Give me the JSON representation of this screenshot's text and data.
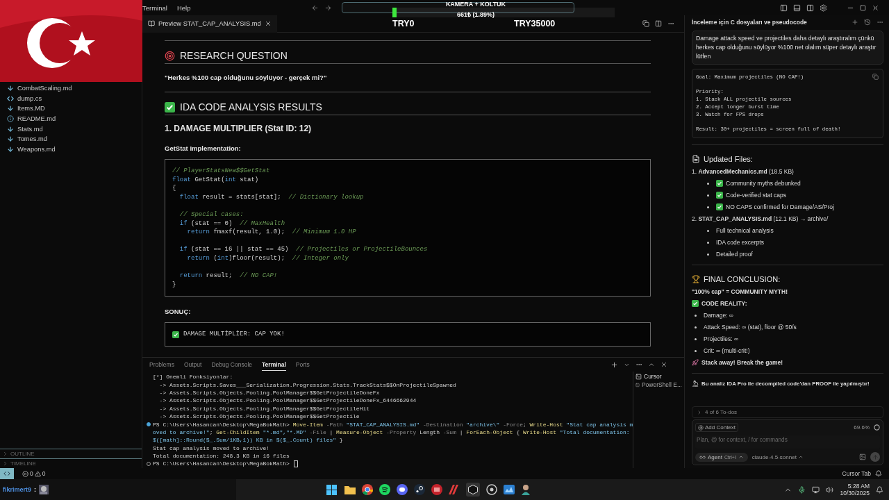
{
  "menu": [
    {
      "label": "Terminal"
    },
    {
      "label": "Help"
    }
  ],
  "overlay": {
    "title": "KAMERA + KOLTUK",
    "amount": "661₺ (1.89%)",
    "level": 0.0189,
    "min": "TRY0",
    "max": "TRY35000"
  },
  "files": [
    {
      "name": "CombatScaling.md",
      "kind": "md"
    },
    {
      "name": "dump.cs",
      "kind": "cs"
    },
    {
      "name": "Items.MD",
      "kind": "md"
    },
    {
      "name": "README.md",
      "kind": "info"
    },
    {
      "name": "Stats.md",
      "kind": "md"
    },
    {
      "name": "Tomes.md",
      "kind": "md"
    },
    {
      "name": "Weapons.md",
      "kind": "md"
    }
  ],
  "sidebar_sections": [
    {
      "label": "OUTLINE",
      "expanded": false
    },
    {
      "label": "TIMELINE",
      "expanded": false
    }
  ],
  "editor_tab": {
    "label": "Preview STAT_CAP_ANALYSIS.md"
  },
  "preview": [
    {
      "kind": "hr"
    },
    {
      "kind": "h2",
      "text": "RESEARCH QUESTION"
    },
    {
      "kind": "bold",
      "text": "\"Herkes %100 cap olduğunu söylüyor - gerçek mi?\""
    },
    {
      "kind": "hr"
    },
    {
      "kind": "h2",
      "text": "IDA CODE ANALYSIS RESULTS"
    },
    {
      "kind": "h3",
      "text": "1. DAMAGE MULTIPLIER (Stat ID: 12)"
    },
    {
      "kind": "bold",
      "text": "GetStat Implementation:"
    },
    {
      "kind": "code",
      "lines": [
        {
          "kind": "code",
          "segs": [
            {
              "kind": "cm",
              "text": "// PlayerStatsNew$$GetStat"
            }
          ]
        },
        {
          "kind": "code",
          "segs": [
            {
              "kind": "kw",
              "text": "float"
            },
            {
              "kind": "tx",
              "text": " GetStat("
            },
            {
              "kind": "kw",
              "text": "int"
            },
            {
              "kind": "tx",
              "text": " stat)"
            }
          ]
        },
        {
          "kind": "code",
          "segs": [
            {
              "kind": "tx",
              "text": "{"
            }
          ]
        },
        {
          "kind": "code",
          "segs": [
            {
              "kind": "kw",
              "text": "  float"
            },
            {
              "kind": "tx",
              "text": " result = stats[stat];  "
            },
            {
              "kind": "cm",
              "text": "// Dictionary lookup"
            }
          ]
        },
        {
          "kind": "blank"
        },
        {
          "kind": "code",
          "segs": [
            {
              "kind": "cm",
              "text": "  // Special cases:"
            }
          ]
        },
        {
          "kind": "code",
          "segs": [
            {
              "kind": "kw",
              "text": "  if"
            },
            {
              "kind": "tx",
              "text": " (stat == 0)  "
            },
            {
              "kind": "cm",
              "text": "// MaxHealth"
            }
          ]
        },
        {
          "kind": "code",
          "segs": [
            {
              "kind": "kw",
              "text": "    return"
            },
            {
              "kind": "tx",
              "text": " fmaxf(result, 1.0);  "
            },
            {
              "kind": "cm",
              "text": "// Minimum 1.0 HP"
            }
          ]
        },
        {
          "kind": "blank"
        },
        {
          "kind": "code",
          "segs": [
            {
              "kind": "kw",
              "text": "  if"
            },
            {
              "kind": "tx",
              "text": " (stat == 16 || stat == 45)  "
            },
            {
              "kind": "cm",
              "text": "// Projectiles or ProjectileBounces"
            }
          ]
        },
        {
          "kind": "code",
          "segs": [
            {
              "kind": "kw",
              "text": "    return"
            },
            {
              "kind": "tx",
              "text": " ("
            },
            {
              "kind": "kw",
              "text": "int"
            },
            {
              "kind": "tx",
              "text": ")floor(result);  "
            },
            {
              "kind": "cm",
              "text": "// Integer only"
            }
          ]
        },
        {
          "kind": "blank"
        },
        {
          "kind": "code",
          "segs": [
            {
              "kind": "kw",
              "text": "  return"
            },
            {
              "kind": "tx",
              "text": " result;  "
            },
            {
              "kind": "cm",
              "text": "// NO CAP!"
            }
          ]
        },
        {
          "kind": "code",
          "segs": [
            {
              "kind": "tx",
              "text": "}"
            }
          ]
        }
      ]
    },
    {
      "kind": "bold",
      "text": "SONUÇ:"
    },
    {
      "kind": "code",
      "lines": [
        {
          "kind": "check",
          "segs": [
            {
              "kind": "tx",
              "text": "DAMAGE MULTİPLİER: CAP YOK!"
            }
          ]
        }
      ]
    }
  ],
  "terminal": {
    "tabs": [
      {
        "label": "Problems",
        "selected": false
      },
      {
        "label": "Output",
        "selected": false
      },
      {
        "label": "Debug Console",
        "selected": false
      },
      {
        "label": "Terminal",
        "selected": true
      },
      {
        "label": "Ports",
        "selected": false
      }
    ],
    "rows": [
      {
        "kind": "out",
        "text": "[*] Onemli Fonksiyonlar:"
      },
      {
        "kind": "out",
        "text": "  -> Assets.Scripts.Saves___Serialization.Progression.Stats.TrackStats$$OnProjectileSpawned"
      },
      {
        "kind": "out",
        "text": "  -> Assets.Scripts.Objects.Pooling.PoolManager$$GetProjectileDoneFx"
      },
      {
        "kind": "out",
        "text": "  -> Assets.Scripts.Objects.Pooling.PoolManager$$GetProjectileDoneFx_6446662944"
      },
      {
        "kind": "out",
        "text": "  -> Assets.Scripts.Objects.Pooling.PoolManager$$GetProjectileHit"
      },
      {
        "kind": "out",
        "text": "  -> Assets.Scripts.Objects.Pooling.PoolManager$$GetProjectile"
      },
      {
        "kind": "cmd",
        "segs": [
          {
            "kind": "tx",
            "text": "PS C:\\Users\\Hasancan\\Desktop\\MegaBokMath> "
          },
          {
            "kind": "cmd",
            "text": "Move-Item"
          },
          {
            "kind": "flag",
            "text": " -Path "
          },
          {
            "kind": "str",
            "text": "\"STAT_CAP_ANALYSIS.md\""
          },
          {
            "kind": "flag",
            "text": " -Destination "
          },
          {
            "kind": "str",
            "text": "\"archive\\\""
          },
          {
            "kind": "flag",
            "text": " -Force"
          },
          {
            "kind": "tx",
            "text": "; "
          },
          {
            "kind": "cmd",
            "text": "Write-Host"
          },
          {
            "kind": "str",
            "text": " \"Stat cap analysis m"
          }
        ]
      },
      {
        "kind": "cont",
        "segs": [
          {
            "kind": "str",
            "text": "oved to archive!\""
          },
          {
            "kind": "tx",
            "text": "; "
          },
          {
            "kind": "cmd",
            "text": "Get-ChildItem"
          },
          {
            "kind": "str",
            "text": " \"*.md\",\"*.MD\""
          },
          {
            "kind": "flag",
            "text": " -File "
          },
          {
            "kind": "tx",
            "text": "| "
          },
          {
            "kind": "cmd",
            "text": "Measure-Object"
          },
          {
            "kind": "flag",
            "text": " -Property "
          },
          {
            "kind": "tx",
            "text": "Length "
          },
          {
            "kind": "flag",
            "text": "-Sum "
          },
          {
            "kind": "tx",
            "text": "| "
          },
          {
            "kind": "cmd",
            "text": "ForEach-Object"
          },
          {
            "kind": "tx",
            "text": " { "
          },
          {
            "kind": "cmd",
            "text": "Write-Host"
          },
          {
            "kind": "str",
            "text": " \"Total documentation:"
          }
        ]
      },
      {
        "kind": "cont",
        "segs": [
          {
            "kind": "str",
            "text": "$([math]::Round($_.Sum/1KB,1)) KB in $($_.Count) files\""
          },
          {
            "kind": "tx",
            "text": " }"
          }
        ]
      },
      {
        "kind": "out",
        "text": "Stat cap analysis moved to archive!"
      },
      {
        "kind": "out",
        "text": "Total documentation: 248.3 KB in 16 files"
      },
      {
        "kind": "idle",
        "segs": [
          {
            "kind": "tx",
            "text": "PS C:\\Users\\Hasancan\\Desktop\\MegaBokMath> "
          }
        ]
      }
    ],
    "sessions": [
      {
        "label": "Cursor",
        "selected": true
      },
      {
        "label": "PowerShell E...",
        "selected": false
      }
    ]
  },
  "chat": {
    "title": "İnceleme için C dosyaları ve pseudocode",
    "user_message": "Damage attack speed ve projectiles daha detaylı araştıralım çünkü herkes cap olduğunu söylüyor %100 net olalım süper detaylı araştır lütfen",
    "blocks": [
      {
        "kind": "code",
        "lines": [
          {
            "kind": "line",
            "text": "Goal: Maximum projectiles (NO CAP!)"
          },
          {
            "kind": "blank"
          },
          {
            "kind": "line",
            "text": "Priority:"
          },
          {
            "kind": "line",
            "text": "1. Stack ALL projectile sources"
          },
          {
            "kind": "line",
            "text": "2. Accept longer burst time"
          },
          {
            "kind": "line",
            "text": "3. Watch for FPS drops"
          },
          {
            "kind": "blank"
          },
          {
            "kind": "line",
            "text": "Result: 30+ projectiles = screen full of death!"
          }
        ]
      },
      {
        "kind": "hr"
      },
      {
        "kind": "h3",
        "text": "Updated Files:"
      },
      {
        "kind": "ol",
        "text": "1. **AdvancedMechanics.md** (18.5 KB)",
        "children": [
          {
            "kind": "check",
            "text": "Community myths debunked"
          },
          {
            "kind": "check",
            "text": "Code-verified stat caps"
          },
          {
            "kind": "check",
            "text": "NO CAPS confirmed for Damage/AS/Proj"
          }
        ]
      },
      {
        "kind": "ol",
        "text": "2. **STAT_CAP_ANALYSIS.md** (12.1 KB) → archive/",
        "children": [
          {
            "kind": "plain",
            "text": "Full technical analysis"
          },
          {
            "kind": "plain",
            "text": "IDA code excerpts"
          },
          {
            "kind": "plain",
            "text": "Detailed proof"
          }
        ]
      },
      {
        "kind": "hr"
      },
      {
        "kind": "h3",
        "text": "FINAL CONCLUSION:"
      },
      {
        "kind": "bold",
        "text": "\"100% cap\" = COMMUNITY MYTH!"
      },
      {
        "kind": "bold",
        "text": "CODE REALITY:"
      },
      {
        "kind": "bullet",
        "text": "Damage: ∞"
      },
      {
        "kind": "bullet",
        "text": "Attack Speed: ∞ (stat), floor @ 50/s"
      },
      {
        "kind": "bullet",
        "text": "Projectiles: ∞"
      },
      {
        "kind": "bullet",
        "text": "Crit: ∞ (multi-crit!)"
      },
      {
        "kind": "bold",
        "text": "Stack away! Break the game!"
      },
      {
        "kind": "hr"
      },
      {
        "kind": "bold",
        "text": "Bu analiz IDA Pro ile decompiled code'dan PROOF ile yapılmıştır!"
      }
    ],
    "todos": {
      "label": "4 of 6 To-dos",
      "expanded": false
    },
    "composer": {
      "add_context": "Add Context",
      "usage": "69.6%",
      "placeholder": "Plan, @ for context, / for commands",
      "mode": "Agent",
      "shortcut": "Ctrl+I",
      "model": "claude-4.5-sonnet"
    }
  },
  "status": {
    "errors": "0",
    "warnings": "0",
    "right": "Cursor Tab"
  },
  "taskbar": {
    "chat_user": "fikrimert9",
    "chat_sep": ":",
    "time": "5:28 AM",
    "date": "10/30/2025"
  }
}
